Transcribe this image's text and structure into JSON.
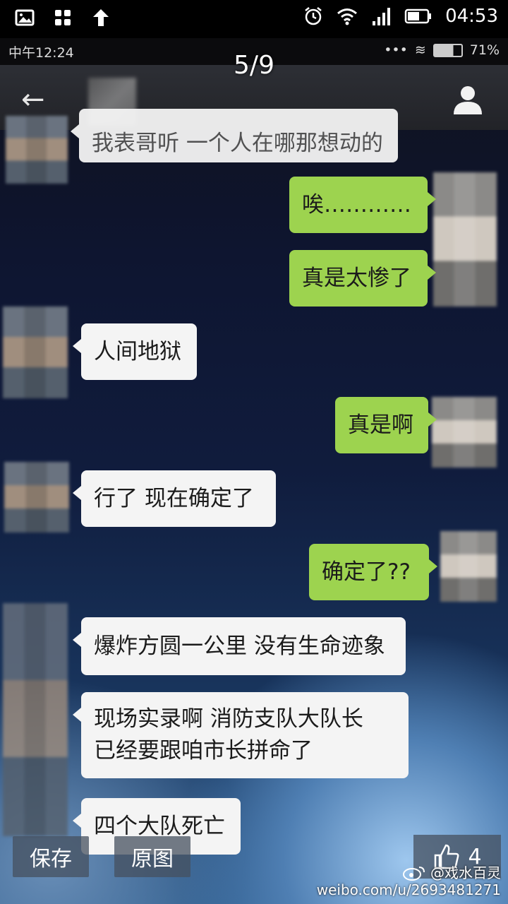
{
  "outer_status": {
    "time": "04:53",
    "left_icons": [
      "image-icon",
      "grid-icon",
      "upload-arrow-icon"
    ],
    "right_icons": [
      "alarm-icon",
      "wifi-icon",
      "signal-icon",
      "battery-icon"
    ]
  },
  "inner_status": {
    "time": "中午12:24",
    "battery": "71%"
  },
  "viewer": {
    "counter": "5/9"
  },
  "messages": [
    {
      "side": "left",
      "text": "我表哥听 一个人在哪那想动的",
      "partial": true
    },
    {
      "side": "right",
      "text": "唉…………"
    },
    {
      "side": "right",
      "text": "真是太惨了"
    },
    {
      "side": "left",
      "text": "人间地狱"
    },
    {
      "side": "right",
      "text": "真是啊"
    },
    {
      "side": "left",
      "text": "行了 现在确定了"
    },
    {
      "side": "right",
      "text": "确定了??"
    },
    {
      "side": "left",
      "text": "爆炸方圆一公里 没有生命迹象"
    },
    {
      "side": "left",
      "line1": "现场实录啊 消防支队大队长",
      "line2": "已经要跟咱市长拼命了"
    },
    {
      "side": "left",
      "text": "四个大队死亡"
    }
  ],
  "actions": {
    "save_label": "保存",
    "original_label": "原图",
    "like_count": "4"
  },
  "watermark": {
    "handle": "@戏水百灵",
    "url": "weibo.com/u/2693481271"
  }
}
